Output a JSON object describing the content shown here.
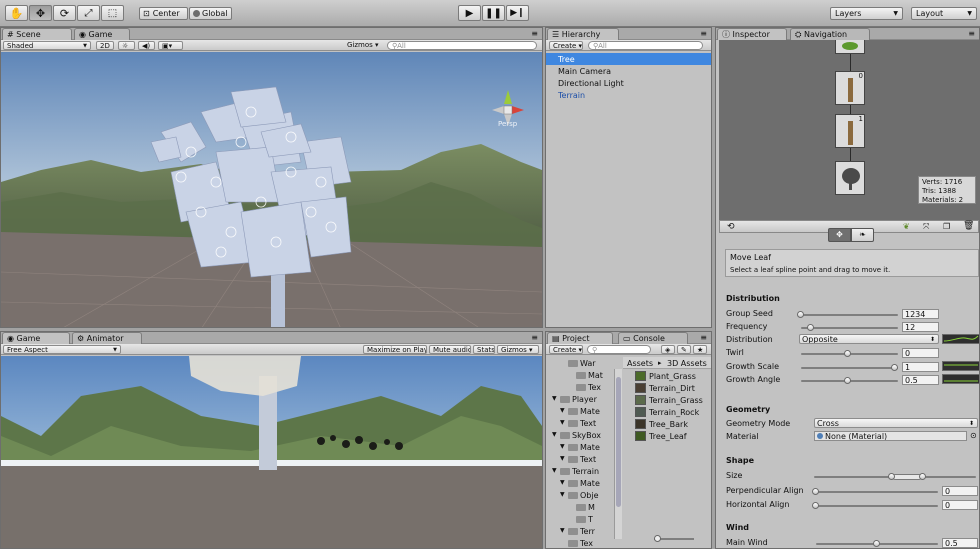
{
  "toolbar": {
    "center_label": "Center",
    "global_label": "Global",
    "layers_label": "Layers",
    "layout_label": "Layout"
  },
  "scene_panel": {
    "tabs": [
      "Scene",
      "Game"
    ],
    "shading_mode": "Shaded",
    "mode_2d": "2D",
    "gizmos_label": "Gizmos",
    "search_placeholder": "All",
    "persp_label": "Persp"
  },
  "game_panel": {
    "tabs": [
      "Game",
      "Animator"
    ],
    "aspect": "Free Aspect",
    "maximize_label": "Maximize on Play",
    "mute_label": "Mute audio",
    "stats_label": "Stats",
    "gizmos_label": "Gizmos"
  },
  "hierarchy": {
    "tab": "Hierarchy",
    "create_label": "Create",
    "search_placeholder": "All",
    "items": [
      {
        "label": "Tree",
        "selected": true,
        "prefab": false
      },
      {
        "label": "Main Camera",
        "selected": false,
        "prefab": false
      },
      {
        "label": "Directional Light",
        "selected": false,
        "prefab": false
      },
      {
        "label": "Terrain",
        "selected": false,
        "prefab": true
      }
    ]
  },
  "project": {
    "tabs": [
      "Project",
      "Console"
    ],
    "create_label": "Create",
    "tree_items": [
      {
        "label": "War",
        "indent": 2
      },
      {
        "label": "Mat",
        "indent": 3
      },
      {
        "label": "Tex",
        "indent": 3
      },
      {
        "label": "Player",
        "indent": 1
      },
      {
        "label": "Mate",
        "indent": 2
      },
      {
        "label": "Text",
        "indent": 2
      },
      {
        "label": "SkyBox",
        "indent": 1
      },
      {
        "label": "Mate",
        "indent": 2
      },
      {
        "label": "Text",
        "indent": 2
      },
      {
        "label": "Terrain",
        "indent": 1
      },
      {
        "label": "Mate",
        "indent": 2
      },
      {
        "label": "Obje",
        "indent": 2
      },
      {
        "label": "M",
        "indent": 3
      },
      {
        "label": "T",
        "indent": 3
      },
      {
        "label": "Terr",
        "indent": 2
      },
      {
        "label": "Tex",
        "indent": 2
      }
    ],
    "breadcrumb_root": "Assets",
    "breadcrumb_sep": "▸",
    "breadcrumb_leaf": "3D Assets",
    "assets": [
      {
        "label": "Plant_Grass",
        "color": "#4c6b2a"
      },
      {
        "label": "Terrain_Dirt",
        "color": "#4a3f33"
      },
      {
        "label": "Terrain_Grass",
        "color": "#5b6a4b"
      },
      {
        "label": "Terrain_Rock",
        "color": "#4f5a52"
      },
      {
        "label": "Tree_Bark",
        "color": "#3b3428"
      },
      {
        "label": "Tree_Leaf",
        "color": "#3f5a22"
      }
    ]
  },
  "inspector": {
    "tabs": [
      "Inspector",
      "Navigation"
    ],
    "stats": {
      "verts": "Verts: 1716",
      "tris": "Tris: 1388",
      "materials": "Materials: 2"
    },
    "node_badges": [
      "0",
      "1"
    ],
    "help_title": "Move Leaf",
    "help_text": "Select a leaf spline point and drag to move it.",
    "distribution": {
      "header": "Distribution",
      "group_seed_label": "Group Seed",
      "group_seed": "1234",
      "frequency_label": "Frequency",
      "frequency": "12",
      "distribution_label": "Distribution",
      "distribution": "Opposite",
      "twirl_label": "Twirl",
      "twirl": "0",
      "growth_scale_label": "Growth Scale",
      "growth_scale": "1",
      "growth_angle_label": "Growth Angle",
      "growth_angle": "0.5"
    },
    "geometry": {
      "header": "Geometry",
      "mode_label": "Geometry Mode",
      "mode": "Cross",
      "material_label": "Material",
      "material": "None (Material)"
    },
    "shape": {
      "header": "Shape",
      "size_label": "Size",
      "perp_label": "Perpendicular Align",
      "perp": "0",
      "horiz_label": "Horizontal Align",
      "horiz": "0"
    },
    "wind": {
      "header": "Wind",
      "main_label": "Main Wind",
      "main": "0.5"
    }
  }
}
